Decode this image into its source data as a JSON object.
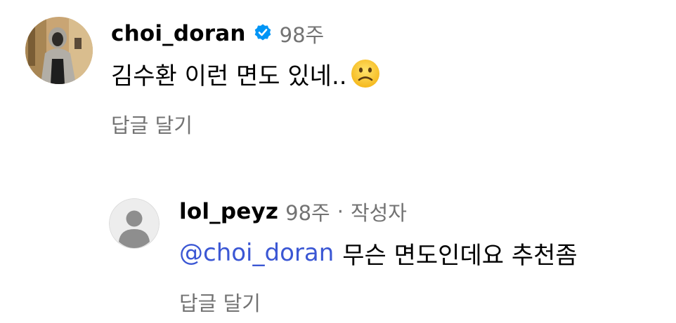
{
  "comment": {
    "username": "choi_doran",
    "verified": true,
    "time": "98주",
    "text": "김수환 이런 면도 있네..",
    "emoji": "slightly-frowning-face",
    "reply_label": "답글 달기"
  },
  "reply": {
    "username": "lol_peyz",
    "time": "98주",
    "separator": "·",
    "author_badge": "작성자",
    "mention": "@choi_doran",
    "text": "무슨 면도인데요 추천좀",
    "reply_label": "답글 달기"
  },
  "colors": {
    "meta": "#737373",
    "mention": "#3b57d4",
    "verified": "#0095f6"
  }
}
